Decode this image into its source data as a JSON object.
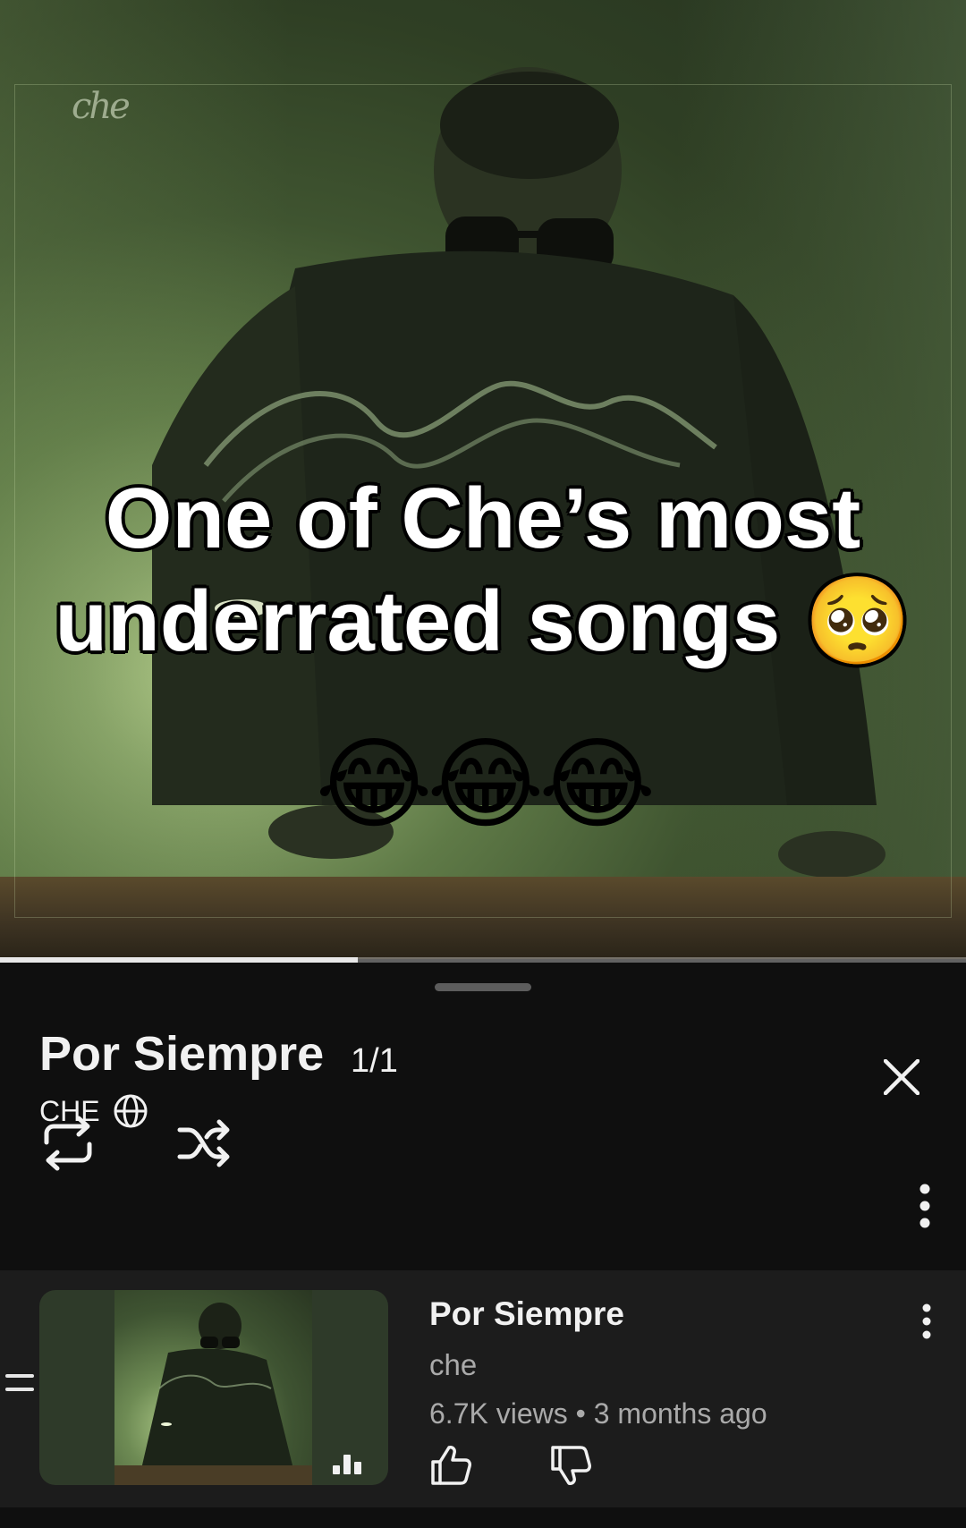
{
  "video": {
    "logo_text": "che",
    "caption_line1": "One of Che’s most",
    "caption_line2": "underrated songs 🥺",
    "emoji_line": "😂😂😂",
    "progress_fraction": 0.37
  },
  "playlist": {
    "title": "Por Siempre",
    "position": "1/1",
    "channel": "CHE",
    "icons": {
      "channel_badge": "globe-icon",
      "close": "close-icon",
      "loop": "loop-icon",
      "shuffle": "shuffle-icon",
      "more": "more-vertical-icon"
    }
  },
  "queue": {
    "items": [
      {
        "title": "Por Siempre",
        "channel": "che",
        "meta": "6.7K views • 3 months ago",
        "now_playing_icon": "equalizer-icon",
        "actions": [
          "like-icon",
          "dislike-icon",
          "more-vertical-icon"
        ]
      }
    ]
  },
  "colors": {
    "background": "#0f0f0f",
    "item_background": "#1c1c1c",
    "primary_text": "#f1f1f1",
    "secondary_text": "#aaaaaa"
  }
}
